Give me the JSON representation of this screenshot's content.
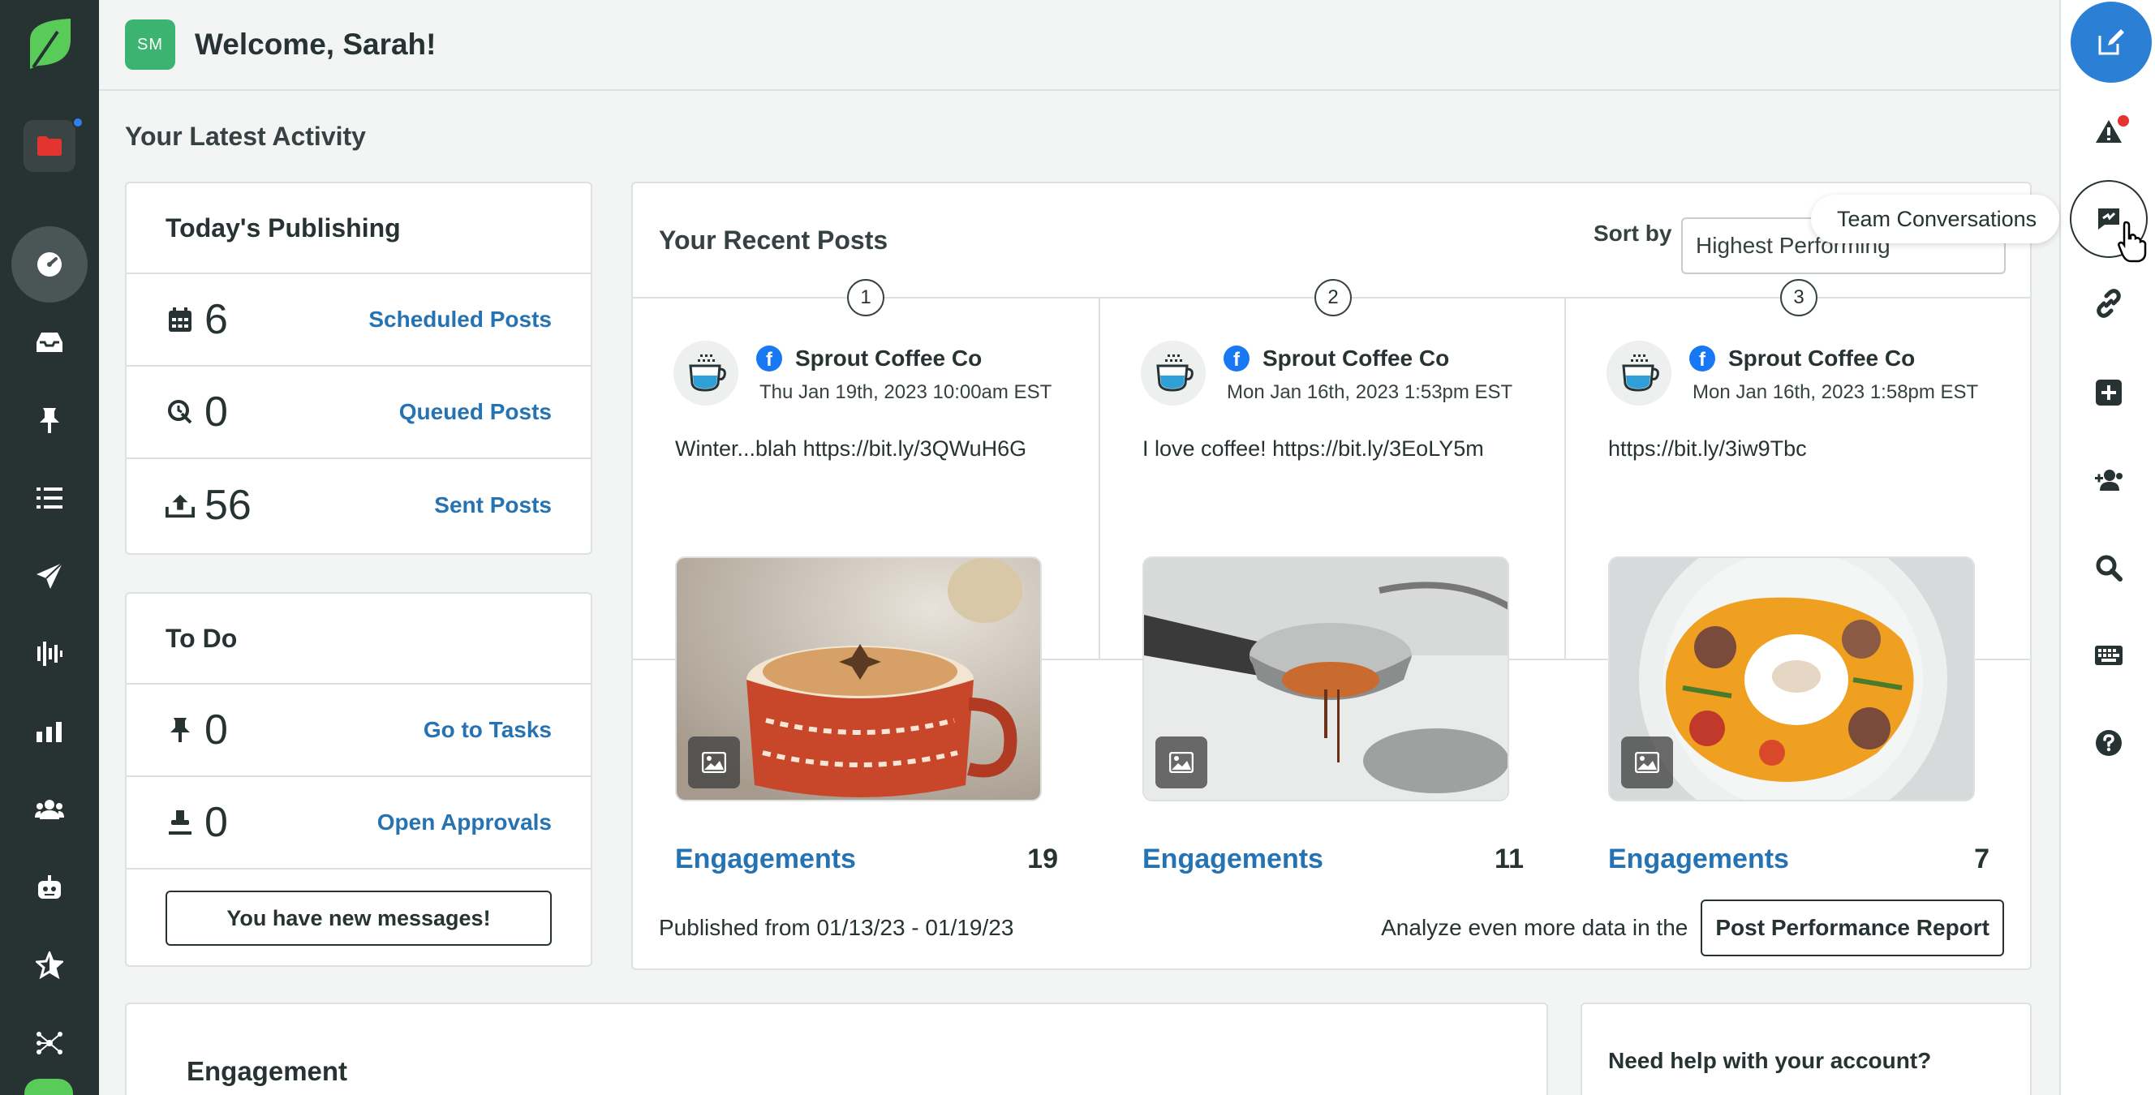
{
  "header": {
    "avatar_initials": "SM",
    "welcome": "Welcome, Sarah!"
  },
  "left_nav": {
    "items": [
      "sprout-logo-icon",
      "folder-icon",
      "dashboard-icon",
      "inbox-icon",
      "pin-icon",
      "list-icon",
      "send-icon",
      "listening-icon",
      "reports-icon",
      "people-icon",
      "bot-icon",
      "star-icon",
      "network-icon"
    ]
  },
  "right_rail": {
    "tooltip": "Team Conversations"
  },
  "activity": {
    "title": "Your Latest Activity"
  },
  "publishing": {
    "title": "Today's Publishing",
    "rows": [
      {
        "icon": "calendar-icon",
        "value": "6",
        "link": "Scheduled Posts"
      },
      {
        "icon": "queue-icon",
        "value": "0",
        "link": "Queued Posts"
      },
      {
        "icon": "upload-icon",
        "value": "56",
        "link": "Sent Posts"
      }
    ]
  },
  "todo": {
    "title": "To Do",
    "rows": [
      {
        "icon": "pin-icon",
        "value": "0",
        "link": "Go to Tasks"
      },
      {
        "icon": "approval-icon",
        "value": "0",
        "link": "Open Approvals"
      }
    ],
    "message_button": "You have new messages!"
  },
  "recent_posts": {
    "title": "Your Recent Posts",
    "sort_label": "Sort by",
    "sort_value": "Highest Performing",
    "posts": [
      {
        "rank": "1",
        "author": "Sprout Coffee Co",
        "date": "Thu Jan 19th, 2023 10:00am EST",
        "text": "Winter...blah https://bit.ly/3QWuH6G",
        "engagement_label": "Engagements",
        "engagements": "19"
      },
      {
        "rank": "2",
        "author": "Sprout Coffee Co",
        "date": "Mon Jan 16th, 2023 1:53pm EST",
        "text": "I love coffee! https://bit.ly/3EoLY5m",
        "engagement_label": "Engagements",
        "engagements": "11"
      },
      {
        "rank": "3",
        "author": "Sprout Coffee Co",
        "date": "Mon Jan 16th, 2023 1:58pm EST",
        "text": "https://bit.ly/3iw9Tbc",
        "engagement_label": "Engagements",
        "engagements": "7"
      }
    ],
    "published_range": "Published from 01/13/23 - 01/19/23",
    "analyze_text": "Analyze even more data in the",
    "report_button": "Post Performance Report"
  },
  "engagement": {
    "title": "Engagement"
  },
  "help": {
    "title": "Need help with your account?"
  }
}
